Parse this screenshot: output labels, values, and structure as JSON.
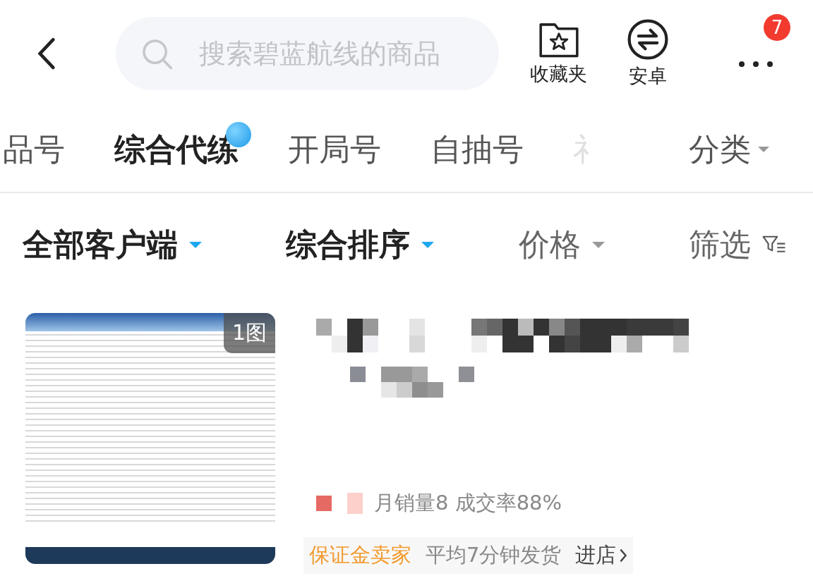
{
  "header": {
    "search": {
      "placeholder": "搜索碧蓝航线的商品"
    },
    "actions": [
      {
        "kind": "favorites",
        "label": "收藏夹"
      },
      {
        "kind": "android",
        "label": "安卓"
      },
      {
        "kind": "more",
        "badge": "7"
      }
    ]
  },
  "tabs": [
    {
      "label": "品号",
      "selected": false,
      "dot": false,
      "faded": false
    },
    {
      "label": "综合代练",
      "selected": true,
      "dot": true,
      "faded": false
    },
    {
      "label": "开局号",
      "selected": false,
      "dot": false,
      "faded": false
    },
    {
      "label": "自抽号",
      "selected": false,
      "dot": false,
      "faded": false
    },
    {
      "label": "礻",
      "selected": false,
      "dot": false,
      "faded": true
    }
  ],
  "category_menu": {
    "label": "分类"
  },
  "filters": [
    {
      "label": "全部客户端",
      "kind": "dropdown",
      "active": true
    },
    {
      "label": "综合排序",
      "kind": "dropdown",
      "active": true
    },
    {
      "label": "价格",
      "kind": "dropdown",
      "active": false
    },
    {
      "label": "筛选",
      "kind": "filter",
      "active": false
    }
  ],
  "product": {
    "image_badge": "1图",
    "stats": "月销量8 成交率88%",
    "seller_tag": "保证金卖家",
    "delivery": "平均7分钟发货",
    "shop_link": "进店"
  }
}
